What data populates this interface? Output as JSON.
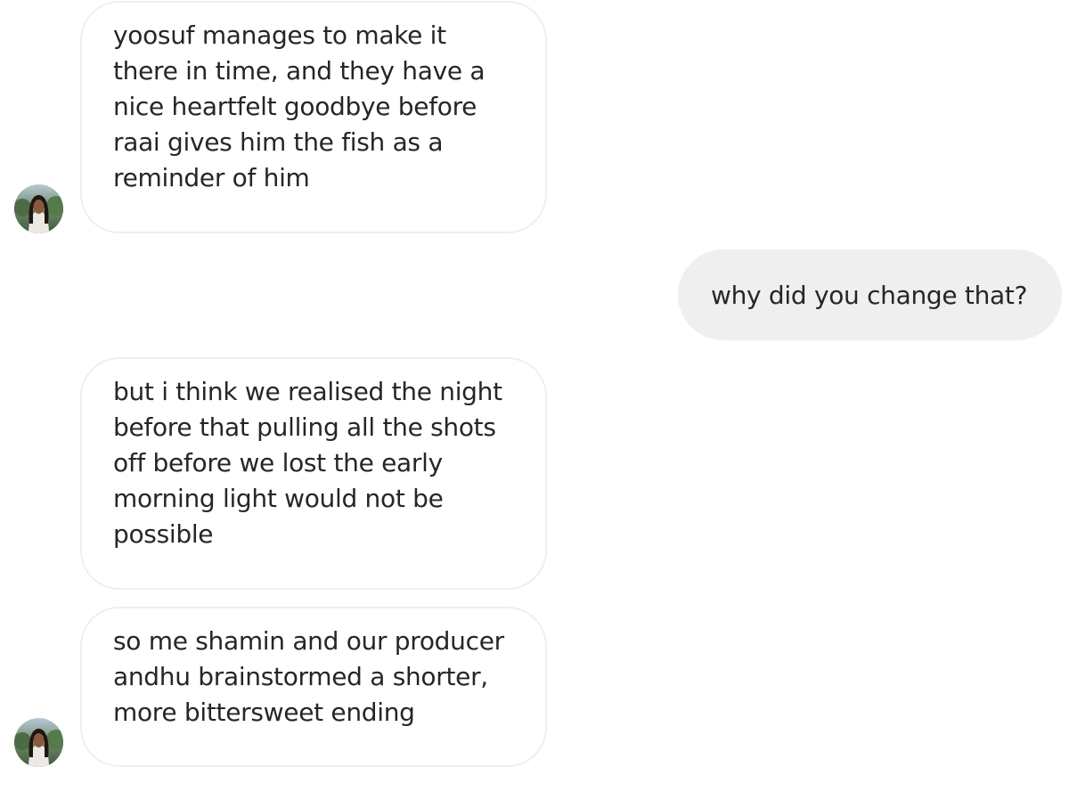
{
  "conversation": {
    "messages": [
      {
        "direction": "incoming",
        "show_avatar": true,
        "text": "yoosuf manages to make it\nthere in time, and they have a\nnice heartfelt goodbye before\nraai gives him the fish as a\nreminder of him"
      },
      {
        "direction": "outgoing",
        "show_avatar": false,
        "text": "why did you change that?"
      },
      {
        "direction": "incoming",
        "show_avatar": false,
        "text": "but i think we realised the night\nbefore that pulling all the shots\noff before we lost the early\nmorning light would not be\npossible"
      },
      {
        "direction": "incoming",
        "show_avatar": true,
        "text": "so me shamin and our producer\nandhu brainstormed a shorter,\nmore bittersweet ending"
      }
    ]
  },
  "colors": {
    "incoming_bubble_bg": "#ffffff",
    "incoming_bubble_border": "#efefef",
    "outgoing_bubble_bg": "#efefef",
    "text": "#262626"
  },
  "icons": {
    "contact_avatar": "contact-avatar-photo"
  }
}
